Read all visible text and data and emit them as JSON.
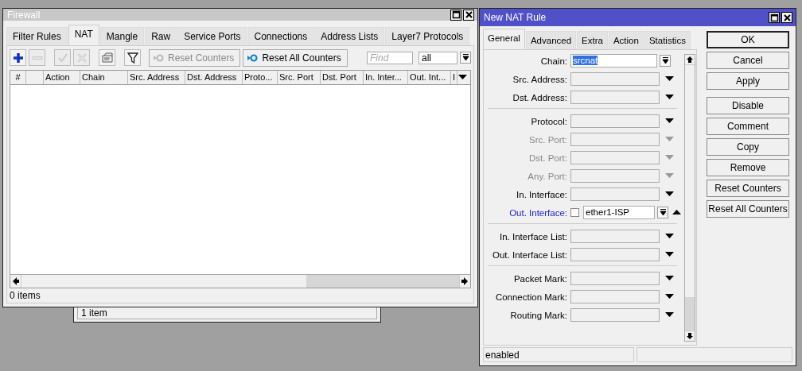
{
  "back_window": {
    "status": "1 item"
  },
  "firewall": {
    "title": "Firewall",
    "tabs": [
      {
        "label": "Filter Rules",
        "selected": false
      },
      {
        "label": "NAT",
        "selected": true
      },
      {
        "label": "Mangle",
        "selected": false
      },
      {
        "label": "Raw",
        "selected": false
      },
      {
        "label": "Service Ports",
        "selected": false
      },
      {
        "label": "Connections",
        "selected": false
      },
      {
        "label": "Address Lists",
        "selected": false
      },
      {
        "label": "Layer7 Protocols",
        "selected": false
      }
    ],
    "tools": [
      {
        "kind": "add",
        "disabled": false
      },
      {
        "kind": "remove",
        "disabled": true
      },
      {
        "kind": "enable",
        "disabled": true
      },
      {
        "kind": "disable",
        "disabled": true
      },
      {
        "kind": "comment",
        "disabled": false
      },
      {
        "kind": "filter",
        "disabled": false
      }
    ],
    "counter_buttons": [
      {
        "label": "Reset Counters",
        "disabled": true
      },
      {
        "label": "Reset All Counters",
        "disabled": false
      }
    ],
    "search": {
      "placeholder": "Find"
    },
    "filter_value": "all",
    "columns": [
      "#",
      "",
      "Action",
      "Chain",
      "Src. Address",
      "Dst. Address",
      "Proto...",
      "Src. Port",
      "Dst. Port",
      "In. Inter...",
      "Out. Int...",
      "I"
    ],
    "status": "0 items"
  },
  "nat_rule": {
    "title": "New NAT Rule",
    "tabs": [
      {
        "label": "General",
        "selected": true
      },
      {
        "label": "Advanced",
        "selected": false
      },
      {
        "label": "Extra",
        "selected": false
      },
      {
        "label": "Action",
        "selected": false
      },
      {
        "label": "Statistics",
        "selected": false
      }
    ],
    "groups": [
      [
        {
          "label": "Chain:",
          "kind": "select",
          "value": "srcnat",
          "value_selected": true,
          "disabled": false,
          "changed": false
        },
        {
          "label": "Src. Address:",
          "kind": "combo",
          "disabled": false,
          "changed": false
        },
        {
          "label": "Dst. Address:",
          "kind": "combo",
          "disabled": false,
          "changed": false
        }
      ],
      [
        {
          "label": "Protocol:",
          "kind": "combo",
          "disabled": false,
          "changed": false
        },
        {
          "label": "Src. Port:",
          "kind": "combo",
          "disabled": true,
          "changed": false
        },
        {
          "label": "Dst. Port:",
          "kind": "combo",
          "disabled": true,
          "changed": false
        },
        {
          "label": "Any. Port:",
          "kind": "combo",
          "disabled": true,
          "changed": false
        },
        {
          "label": "In. Interface:",
          "kind": "combo",
          "disabled": false,
          "changed": false
        },
        {
          "label": "Out. Interface:",
          "kind": "negatable",
          "value": "ether1-ISP",
          "value_selected": false,
          "negated": false,
          "disabled": false,
          "changed": true
        }
      ],
      [
        {
          "label": "In. Interface List:",
          "kind": "combo",
          "disabled": false,
          "changed": false
        },
        {
          "label": "Out. Interface List:",
          "kind": "combo",
          "disabled": false,
          "changed": false
        }
      ],
      [
        {
          "label": "Packet Mark:",
          "kind": "combo",
          "disabled": false,
          "changed": false
        },
        {
          "label": "Connection Mark:",
          "kind": "combo",
          "disabled": false,
          "changed": false
        },
        {
          "label": "Routing Mark:",
          "kind": "combo",
          "disabled": false,
          "changed": false
        }
      ]
    ],
    "button_groups": [
      [
        {
          "label": "OK",
          "default": true
        },
        {
          "label": "Cancel",
          "default": false
        },
        {
          "label": "Apply",
          "default": false
        }
      ],
      [
        {
          "label": "Disable",
          "default": false
        },
        {
          "label": "Comment",
          "default": false
        },
        {
          "label": "Copy",
          "default": false
        },
        {
          "label": "Remove",
          "default": false
        },
        {
          "label": "Reset Counters",
          "default": false
        },
        {
          "label": "Reset All Counters",
          "default": false
        }
      ]
    ],
    "status": "enabled"
  }
}
